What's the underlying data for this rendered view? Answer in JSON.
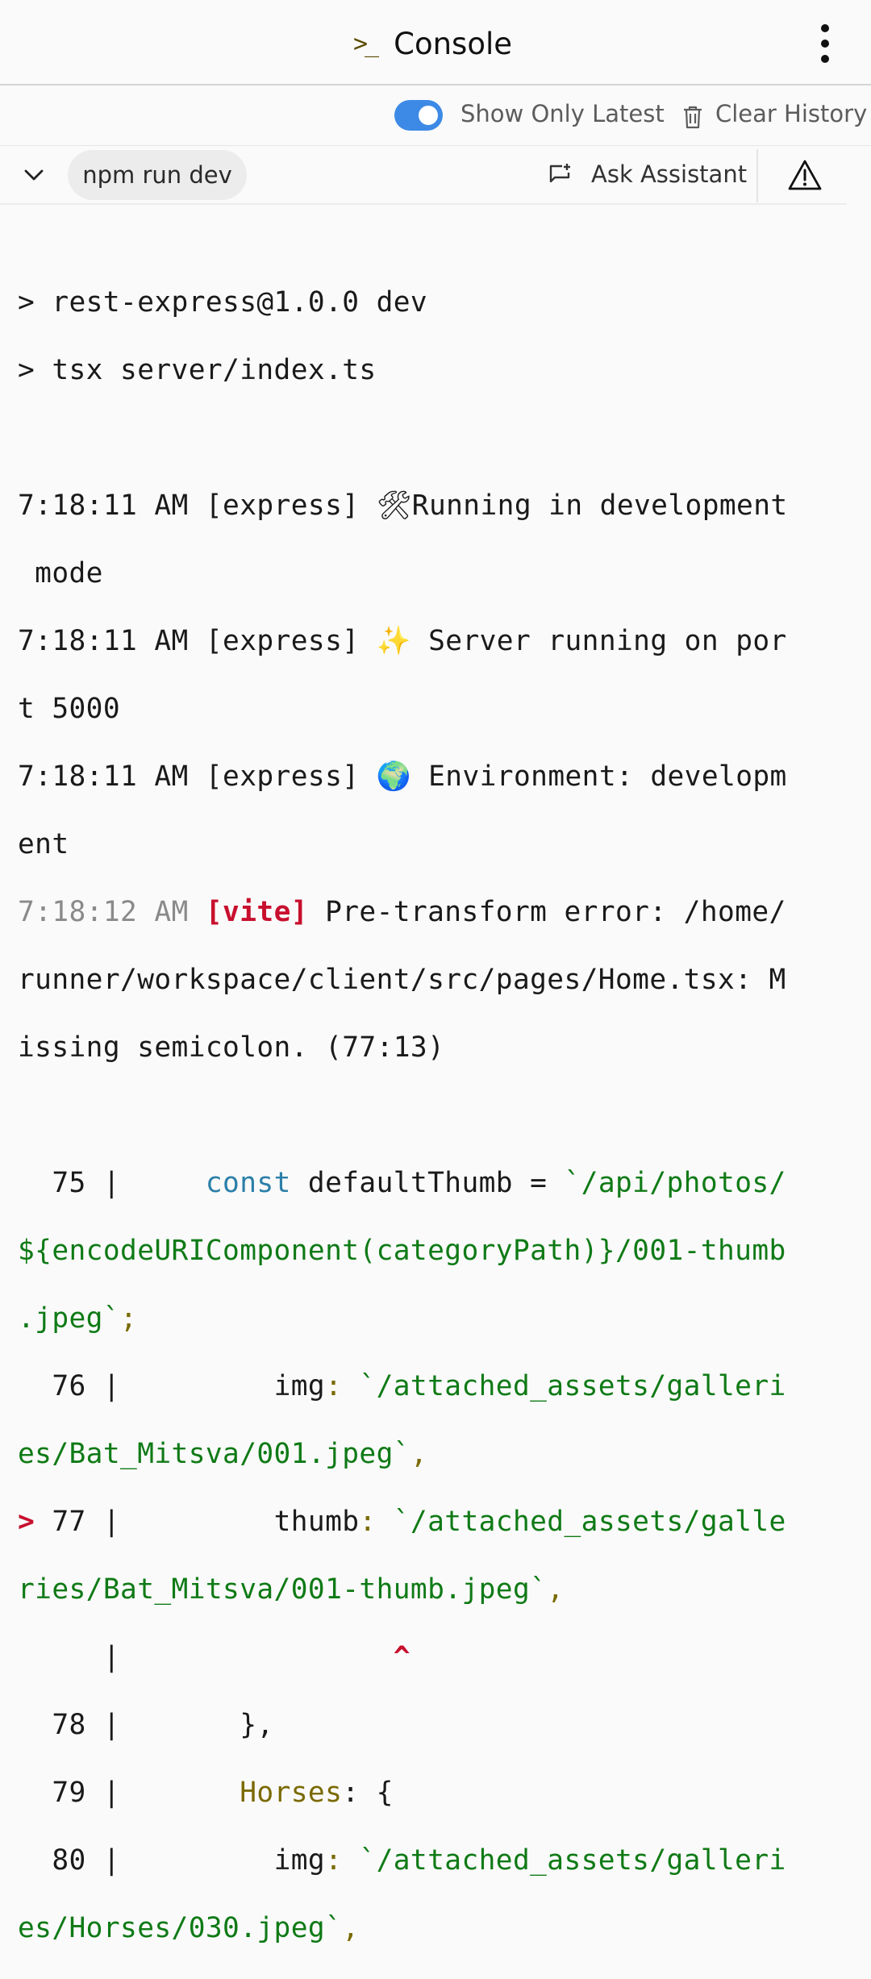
{
  "header": {
    "title": "Console",
    "prompt_icon": ">_",
    "menu_icon": "kebab-menu-icon"
  },
  "toolbar": {
    "toggle_label": "Show Only Latest",
    "toggle_on": true,
    "clear_label": "Clear History",
    "accent": "#3d8ae6"
  },
  "command": {
    "chip_label": "npm run dev",
    "ask_label": "Ask Assistant"
  },
  "console": {
    "line1": "> rest-express@1.0.0 dev",
    "line2": "> tsx server/index.ts",
    "e1_prefix": "7:18:11 AM [express] ",
    "e1_emoji": "🛠",
    "e1_text": "Running in development",
    "e1_wrap": " mode",
    "e2_prefix": "7:18:11 AM [express] ",
    "e2_emoji": "✨",
    "e2_text": " Server running on por",
    "e2_wrap": "t 5000",
    "e3_prefix": "7:18:11 AM [express] ",
    "e3_emoji": "🌍",
    "e3_text": " Environment: developm",
    "e3_wrap": "ent",
    "v_time": "7:18:12 AM ",
    "v_tag": "[vite]",
    "v_text": " Pre-transform error: /home/",
    "v_wrap1": "runner/workspace/client/src/pages/Home.tsx: M",
    "v_wrap2": "issing semicolon. (77:13)",
    "c75_gutter": "  75 |     ",
    "c75_kw": "const",
    "c75_mid": " defaultThumb = ",
    "c75_str": "`/api/photos/",
    "c75_wrap1": "${encodeURIComponent(categoryPath)}/001-thumb",
    "c75_wrap2": ".jpeg`",
    "c75_end": ";",
    "c76_gutter": "  76 |         ",
    "c76_key": "img",
    "c76_colon": ": ",
    "c76_str": "`/attached_assets/galleri",
    "c76_wrap": "es/Bat_Mitsva/001.jpeg`",
    "c76_end": ",",
    "c77_marker": ">",
    "c77_gutter": " 77 |         ",
    "c77_key": "thumb",
    "c77_colon": ": ",
    "c77_str": "`/attached_assets/galle",
    "c77_wrap": "ries/Bat_Mitsva/001-thumb.jpeg`",
    "c77_end": ",",
    "caret_gutter": "     |",
    "caret_pad": "                ",
    "caret": "^",
    "c78_gutter": "  78 |       ",
    "c78_text": "},",
    "c79_gutter": "  79 |       ",
    "c79_key": "Horses",
    "c79_rest": ": {",
    "c80_gutter": "  80 |         ",
    "c80_key": "img",
    "c80_colon": ": ",
    "c80_str": "`/attached_assets/galleri",
    "c80_wrap": "es/Horses/030.jpeg`",
    "c80_end": ","
  }
}
